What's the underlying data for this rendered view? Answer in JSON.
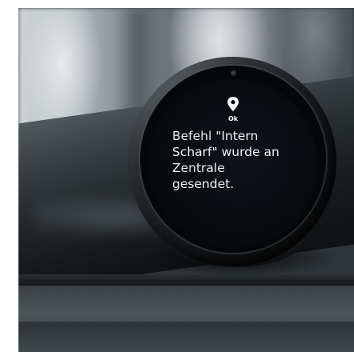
{
  "scene": {
    "description_colors": {
      "screen_background": "#07090c",
      "text": "#f2f2f2",
      "indicator": "#ffffff"
    }
  },
  "device_screen": {
    "icon": "location-pin-icon",
    "status_label": "Ok",
    "message_lines": [
      "Befehl \"Intern",
      "Scharf\" wurde an",
      "Zentrale",
      "gesendet."
    ]
  }
}
